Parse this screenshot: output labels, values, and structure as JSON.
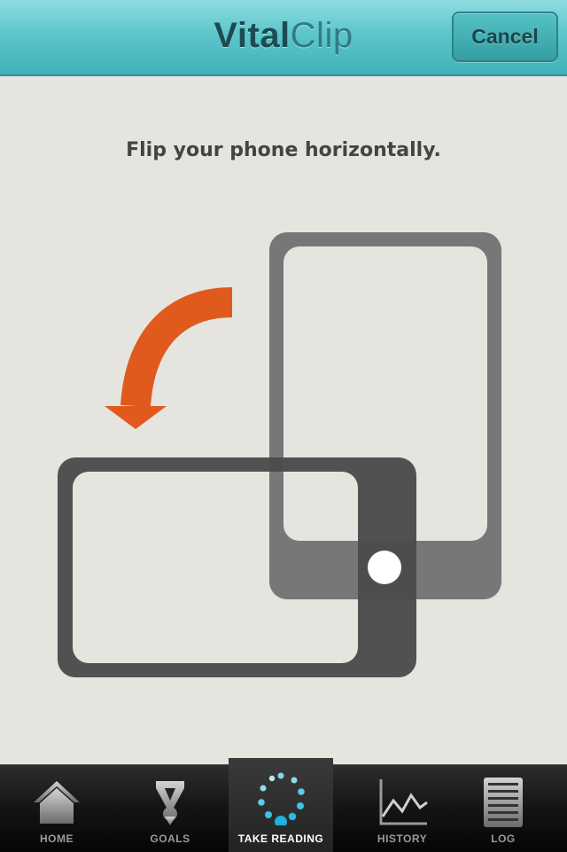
{
  "header": {
    "title_part1": "Vital",
    "title_part2": "Clip",
    "cancel_label": "Cancel"
  },
  "main": {
    "instruction": "Flip your phone horizontally."
  },
  "colors": {
    "accent": "#4fc3c7",
    "arrow": "#e05a1e",
    "background": "#e6e4df"
  },
  "tabs": [
    {
      "label": "HOME",
      "icon": "home-icon",
      "active": false
    },
    {
      "label": "GOALS",
      "icon": "goals-icon",
      "active": false
    },
    {
      "label": "TAKE READING",
      "icon": "take-reading-icon",
      "active": true
    },
    {
      "label": "HISTORY",
      "icon": "history-icon",
      "active": false
    },
    {
      "label": "LOG",
      "icon": "log-icon",
      "active": false
    }
  ]
}
